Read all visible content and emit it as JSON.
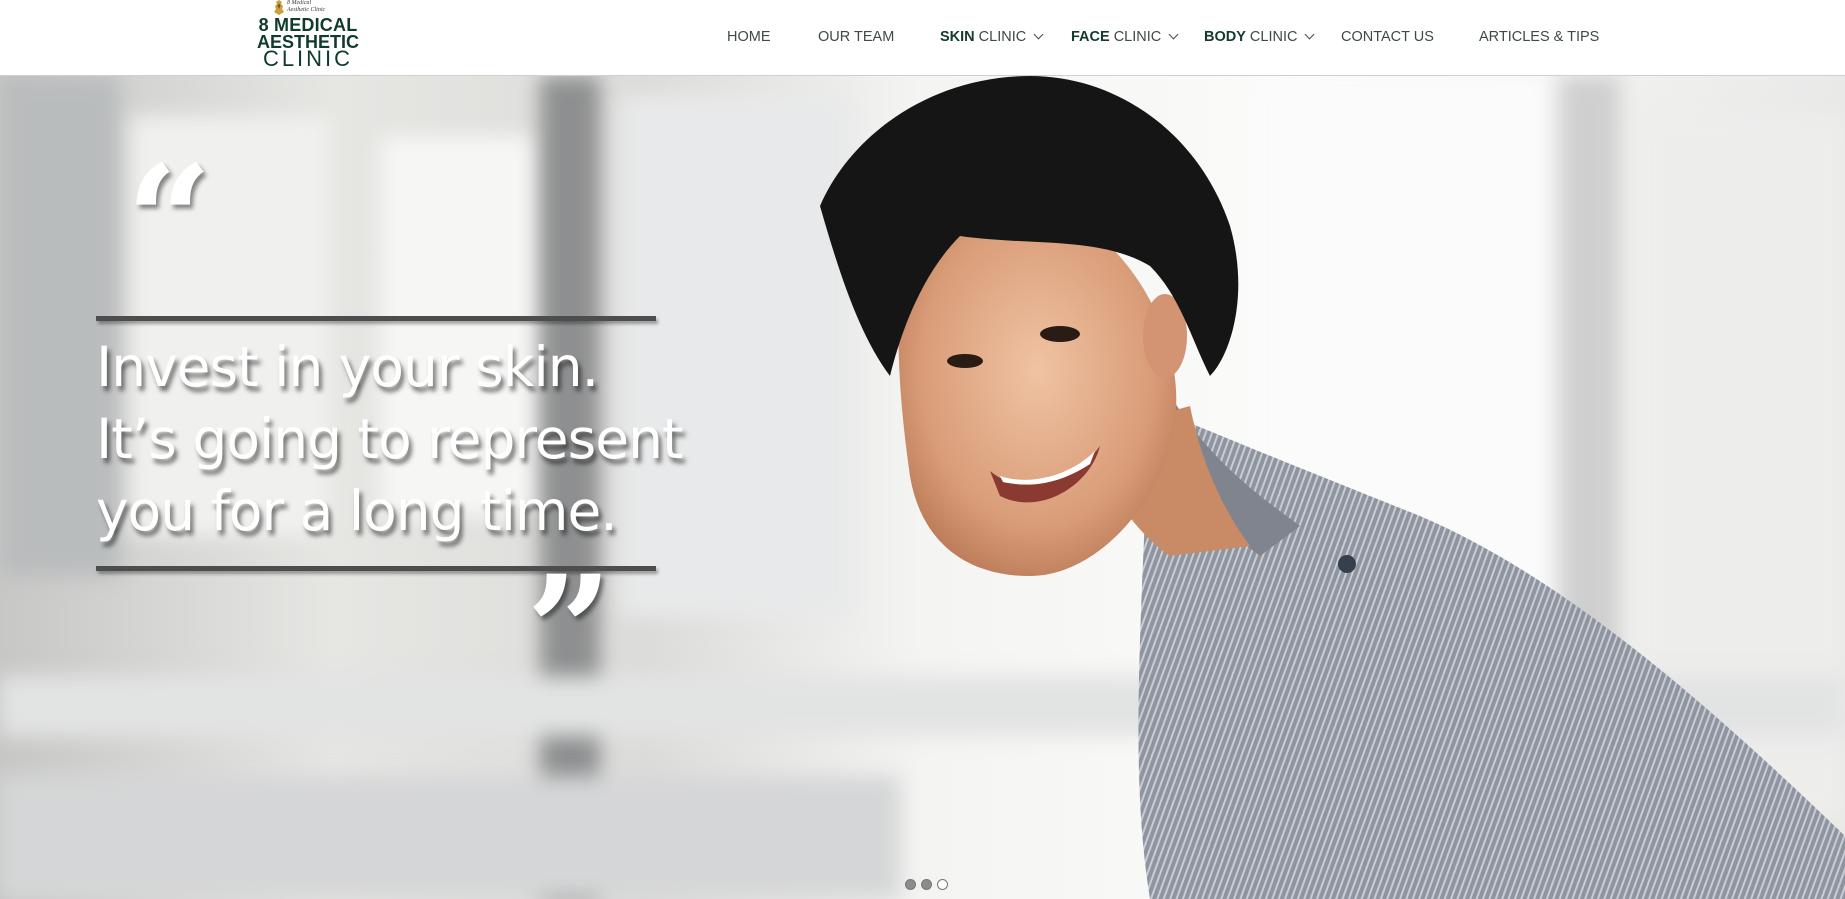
{
  "brand": {
    "tagline": "8 Medical\nAesthetic Clinic",
    "line1": "8 MEDICAL",
    "line2": "AESTHETIC",
    "line3": "CLINIC",
    "color": "#0f3b2a"
  },
  "nav": {
    "items": [
      {
        "bold": "",
        "label": "HOME",
        "dropdown": false
      },
      {
        "bold": "",
        "label": "OUR TEAM",
        "dropdown": false
      },
      {
        "bold": "SKIN",
        "label": " CLINIC",
        "dropdown": true
      },
      {
        "bold": "FACE",
        "label": " CLINIC",
        "dropdown": true
      },
      {
        "bold": "BODY",
        "label": " CLINIC",
        "dropdown": true
      },
      {
        "bold": "",
        "label": "CONTACT US",
        "dropdown": false
      },
      {
        "bold": "",
        "label": "ARTICLES & TIPS",
        "dropdown": false
      }
    ],
    "text_color": "#3e4a44"
  },
  "hero": {
    "quote_open": "“",
    "quote_close": "”",
    "quote_lines": [
      "Invest in your skin.",
      "It’s going to represent",
      "you for a long time."
    ],
    "slider": {
      "total": 3,
      "active_index": 3
    }
  },
  "icons": [
    "chevron-down-icon",
    "crest-icon"
  ]
}
